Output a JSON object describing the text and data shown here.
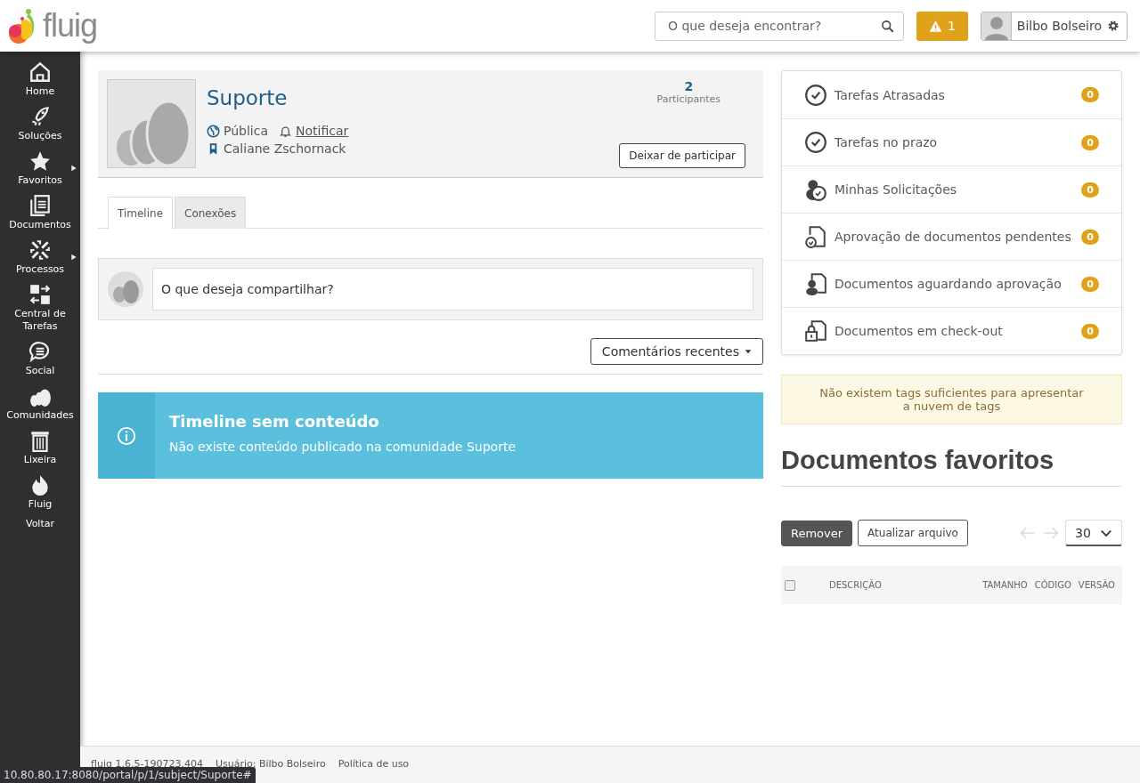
{
  "header": {
    "logo_text": "fluig",
    "search": {
      "placeholder": "O que deseja encontrar?"
    },
    "alerts": "1",
    "user": "Bilbo Bolseiro"
  },
  "sidebar": {
    "items": [
      {
        "label": "Home",
        "submenu": false
      },
      {
        "label": "Soluções",
        "submenu": false
      },
      {
        "label": "Favoritos",
        "submenu": true
      },
      {
        "label": "Documentos",
        "submenu": false
      },
      {
        "label": "Processos",
        "submenu": true
      },
      {
        "label": "Central de Tarefas",
        "submenu": false
      },
      {
        "label": "Social",
        "submenu": false
      },
      {
        "label": "Comunidades",
        "submenu": false
      },
      {
        "label": "Lixeira",
        "submenu": false
      },
      {
        "label": "Fluig",
        "submenu": false
      },
      {
        "label": "Voltar",
        "submenu": false
      }
    ]
  },
  "community": {
    "name": "Suporte",
    "visibility": "Pública",
    "notify": "Notificar",
    "owner": "Caliane Zschornack",
    "participants_count": "2",
    "participants_label": "Participantes",
    "leave_button": "Deixar de participar"
  },
  "tabs": [
    {
      "label": "Timeline",
      "selected": true
    },
    {
      "label": "Conexões",
      "selected": false
    }
  ],
  "composer": {
    "placeholder": "O que deseja compartilhar?"
  },
  "sort_button": "Comentários recentes",
  "empty_alert": {
    "title": "Timeline sem conteúdo",
    "message": "Não existe conteúdo publicado na comunidade Suporte"
  },
  "tasks": [
    {
      "label": "Tarefas Atrasadas",
      "count": "0"
    },
    {
      "label": "Tarefas no prazo",
      "count": "0"
    },
    {
      "label": "Minhas Solicitações",
      "count": "0"
    },
    {
      "label": "Aprovação de documentos pendentes",
      "count": "0"
    },
    {
      "label": "Documentos aguardando aprovação",
      "count": "0"
    },
    {
      "label": "Documentos em check-out",
      "count": "0"
    }
  ],
  "tag_cloud_notice": "Não existem tags suficientes para apresentar a nuvem de tags",
  "favorites": {
    "title": "Documentos favoritos",
    "buttons": [
      "Remover",
      "Atualizar arquivo"
    ],
    "page_size": "30",
    "select_all_checked": false,
    "columns": [
      "DESCRIÇÃO",
      "TAMANHO",
      "CÓDIGO",
      "VERSÃO"
    ]
  },
  "footer": {
    "version": "fluig 1.6.5-190723.404",
    "user": "Usuário: Bilbo Bolseiro",
    "policy_link": "Política de uso"
  },
  "status_url": "10.80.80.17:8080/portal/p/1/subject/Suporte#"
}
